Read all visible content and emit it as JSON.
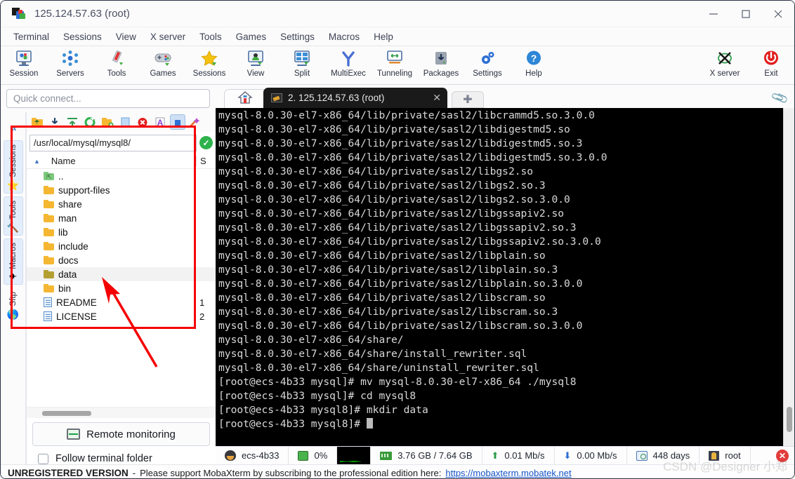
{
  "window": {
    "title": "125.124.57.63 (root)",
    "icon": "mobaxterm-logo-icon",
    "minimize": "—",
    "maximize": "□",
    "close": "✕"
  },
  "menubar": {
    "items": [
      {
        "label": "Terminal"
      },
      {
        "label": "Sessions"
      },
      {
        "label": "View"
      },
      {
        "label": "X server"
      },
      {
        "label": "Tools"
      },
      {
        "label": "Games"
      },
      {
        "label": "Settings"
      },
      {
        "label": "Macros"
      },
      {
        "label": "Help"
      }
    ]
  },
  "toolbar": {
    "left_items": [
      {
        "label": "Session",
        "icon": "session-icon"
      },
      {
        "label": "Servers",
        "icon": "servers-icon"
      },
      {
        "label": "Tools",
        "icon": "tools-icon"
      },
      {
        "label": "Games",
        "icon": "gamepad-icon"
      },
      {
        "label": "Sessions",
        "icon": "star-icon"
      },
      {
        "label": "View",
        "icon": "view-icon"
      },
      {
        "label": "Split",
        "icon": "split-icon"
      },
      {
        "label": "MultiExec",
        "icon": "multiexec-icon"
      },
      {
        "label": "Tunneling",
        "icon": "tunneling-icon"
      },
      {
        "label": "Packages",
        "icon": "packages-icon"
      },
      {
        "label": "Settings",
        "icon": "gear-icon"
      },
      {
        "label": "Help",
        "icon": "help-icon"
      }
    ],
    "right_items": [
      {
        "label": "X server",
        "icon": "x-server-icon"
      },
      {
        "label": "Exit",
        "icon": "power-icon"
      }
    ]
  },
  "sidebar": {
    "quick_connect_placeholder": "Quick connect...",
    "collapse_label": "«",
    "tabs": [
      {
        "label": "Sessions",
        "icon": "star-icon",
        "active": true
      },
      {
        "label": "Tools",
        "icon": "tools-icon",
        "active": true
      },
      {
        "label": "Macros",
        "icon": "paper-plane-icon",
        "active": true
      },
      {
        "label": "Sftp",
        "icon": "globe-icon",
        "active": false
      }
    ]
  },
  "sftp": {
    "toolbar_icons": [
      {
        "name": "parent-folder-icon"
      },
      {
        "name": "download-icon"
      },
      {
        "name": "upload-icon"
      },
      {
        "name": "refresh-icon"
      },
      {
        "name": "new-folder-icon"
      },
      {
        "name": "new-file-icon"
      },
      {
        "name": "delete-icon"
      },
      {
        "name": "text-mode-icon"
      },
      {
        "name": "binary-mode-icon"
      },
      {
        "name": "magic-wand-icon"
      }
    ],
    "path": "/usr/local/mysql/mysql8/",
    "path_ok_icon": "✓",
    "columns": {
      "name": "Name",
      "size": "S"
    },
    "sort_indicator": "▲",
    "rows": [
      {
        "name": "..",
        "type": "parent",
        "size": ""
      },
      {
        "name": "support-files",
        "type": "folder",
        "size": ""
      },
      {
        "name": "share",
        "type": "folder",
        "size": ""
      },
      {
        "name": "man",
        "type": "folder",
        "size": ""
      },
      {
        "name": "lib",
        "type": "folder",
        "size": ""
      },
      {
        "name": "include",
        "type": "folder",
        "size": ""
      },
      {
        "name": "docs",
        "type": "folder",
        "size": ""
      },
      {
        "name": "data",
        "type": "folder-selected",
        "size": ""
      },
      {
        "name": "bin",
        "type": "folder",
        "size": ""
      },
      {
        "name": "README",
        "type": "file",
        "size": "1"
      },
      {
        "name": "LICENSE",
        "type": "file",
        "size": "2"
      }
    ],
    "remote_monitoring_label": "Remote monitoring",
    "remote_monitoring_icon": "monitor-icon",
    "follow_terminal_label": "Follow terminal folder",
    "follow_terminal_checked": false
  },
  "tabbar": {
    "home_tab_icon": "home-icon",
    "terminal_tab": {
      "label": "2. 125.124.57.63 (root)",
      "icon": "terminal-icon",
      "close": "✕"
    },
    "add_tab_label": "✚",
    "clip_icon": "paperclip-icon"
  },
  "terminal": {
    "lines": [
      "mysql-8.0.30-el7-x86_64/lib/private/sasl2/libcrammd5.so.3.0.0",
      "mysql-8.0.30-el7-x86_64/lib/private/sasl2/libdigestmd5.so",
      "mysql-8.0.30-el7-x86_64/lib/private/sasl2/libdigestmd5.so.3",
      "mysql-8.0.30-el7-x86_64/lib/private/sasl2/libdigestmd5.so.3.0.0",
      "mysql-8.0.30-el7-x86_64/lib/private/sasl2/libgs2.so",
      "mysql-8.0.30-el7-x86_64/lib/private/sasl2/libgs2.so.3",
      "mysql-8.0.30-el7-x86_64/lib/private/sasl2/libgs2.so.3.0.0",
      "mysql-8.0.30-el7-x86_64/lib/private/sasl2/libgssapiv2.so",
      "mysql-8.0.30-el7-x86_64/lib/private/sasl2/libgssapiv2.so.3",
      "mysql-8.0.30-el7-x86_64/lib/private/sasl2/libgssapiv2.so.3.0.0",
      "mysql-8.0.30-el7-x86_64/lib/private/sasl2/libplain.so",
      "mysql-8.0.30-el7-x86_64/lib/private/sasl2/libplain.so.3",
      "mysql-8.0.30-el7-x86_64/lib/private/sasl2/libplain.so.3.0.0",
      "mysql-8.0.30-el7-x86_64/lib/private/sasl2/libscram.so",
      "mysql-8.0.30-el7-x86_64/lib/private/sasl2/libscram.so.3",
      "mysql-8.0.30-el7-x86_64/lib/private/sasl2/libscram.so.3.0.0",
      "mysql-8.0.30-el7-x86_64/share/",
      "mysql-8.0.30-el7-x86_64/share/install_rewriter.sql",
      "mysql-8.0.30-el7-x86_64/share/uninstall_rewriter.sql",
      "[root@ecs-4b33 mysql]# mv mysql-8.0.30-el7-x86_64 ./mysql8",
      "[root@ecs-4b33 mysql]# cd mysql8",
      "[root@ecs-4b33 mysql8]# mkdir data",
      "[root@ecs-4b33 mysql8]# "
    ]
  },
  "statusbar": {
    "host": "ecs-4b33",
    "cpu": "0%",
    "memory": "3.76 GB / 7.64 GB",
    "upload": "0.01 Mb/s",
    "download": "0.00 Mb/s",
    "uptime": "448 days",
    "user": "root",
    "close": "✕"
  },
  "footer": {
    "unregistered": "UNREGISTERED VERSION",
    "dash": "-",
    "message": "Please support MobaXterm by subscribing to the professional edition here:",
    "link": "https://mobaxterm.mobatek.net"
  },
  "watermark": "CSDN @Designer 小郑",
  "colors": {
    "accent_blue": "#2d6fd4",
    "annotation_red": "#f50000",
    "terminal_bg": "#000000",
    "terminal_fg": "#d9d9d9",
    "link": "#1554c8"
  }
}
